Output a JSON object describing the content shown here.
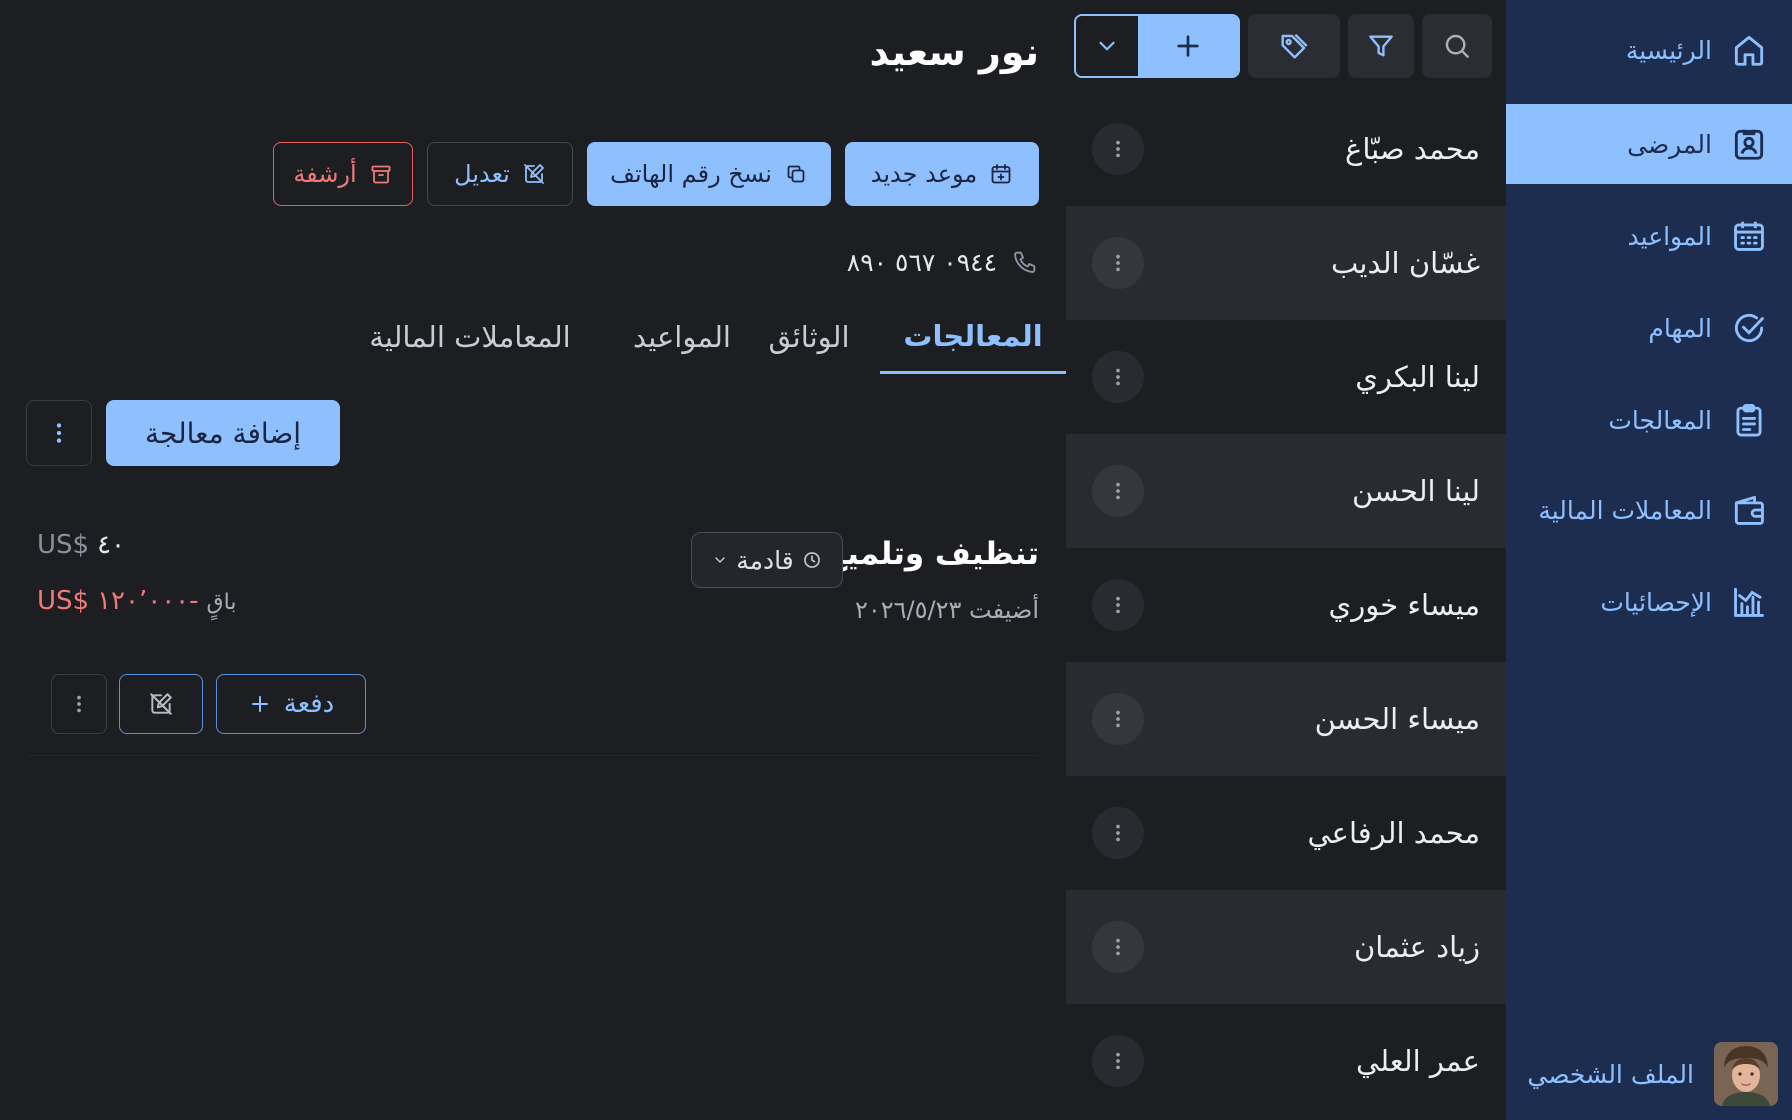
{
  "sidebar": {
    "items": [
      {
        "label": "الرئيسية",
        "icon": "home-icon"
      },
      {
        "label": "المرضى",
        "icon": "patient-id-icon",
        "active": true
      },
      {
        "label": "المواعيد",
        "icon": "calendar-icon"
      },
      {
        "label": "المهام",
        "icon": "check-circle-icon"
      },
      {
        "label": "المعالجات",
        "icon": "clipboard-icon"
      },
      {
        "label": "المعاملات المالية",
        "icon": "wallet-icon"
      },
      {
        "label": "الإحصائيات",
        "icon": "bar-chart-icon"
      }
    ],
    "profile_label": "الملف الشخصي"
  },
  "patients": [
    "محمد صبّاغ",
    "غسّان الديب",
    "لينا البكري",
    "لينا الحسن",
    "ميساء خوري",
    "ميساء الحسن",
    "محمد الرفاعي",
    "زياد عثمان",
    "عمر العلي"
  ],
  "patient": {
    "name": "نور سعيد",
    "phone": "٠٩٤٤ ٥٦٧ ٨٩٠"
  },
  "actions": {
    "new_appointment": "موعد جديد",
    "copy_phone": "نسخ رقم الهاتف",
    "edit": "تعديل",
    "archive": "أرشفة"
  },
  "tabs": [
    "المعالجات",
    "الوثائق",
    "المواعيد",
    "المعاملات المالية"
  ],
  "add_treatment_label": "إضافة معالجة",
  "treatment": {
    "name": "تنظيف وتلميع",
    "status": "قادمة",
    "added": "أضيفت ٢٠٢٦/٥/٢٣",
    "price": "٤٠",
    "currency": "$US",
    "remaining_label": "باقٍ",
    "remaining": "-١٢٠٬٠٠٠",
    "pay_label": "دفعة"
  },
  "colors": {
    "accent": "#8ec0ff",
    "sidebar_bg": "#1d2d50",
    "danger": "#f07a7a",
    "background": "#1d1e22"
  }
}
